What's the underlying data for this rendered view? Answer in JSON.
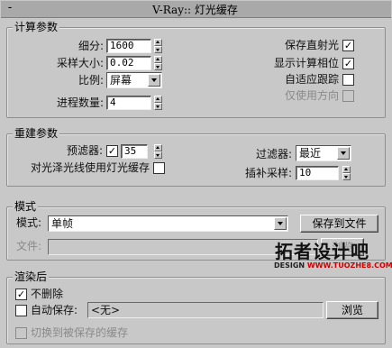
{
  "window": {
    "title": "V-Ray:: 灯光缓存",
    "collapse_glyph": "-"
  },
  "calc": {
    "legend": "计算参数",
    "subdivs_label": "细分:",
    "subdivs_value": "1600",
    "sample_size_label": "采样大小:",
    "sample_size_value": "0.02",
    "scale_label": "比例:",
    "scale_value": "屏幕",
    "passes_label": "进程数量:",
    "passes_value": "4",
    "store_direct_label": "保存直射光",
    "store_direct_checked": true,
    "show_calc_label": "显示计算相位",
    "show_calc_checked": true,
    "adaptive_label": "自适应跟踪",
    "adaptive_checked": false,
    "use_dirs_label": "仅使用方向",
    "use_dirs_checked": false
  },
  "recon": {
    "legend": "重建参数",
    "prefilter_label": "预滤器:",
    "prefilter_checked": true,
    "prefilter_value": "35",
    "glossy_label": "对光泽光线使用灯光缓存",
    "glossy_checked": false,
    "filter_label": "过滤器:",
    "filter_value": "最近",
    "interp_label": "插补采样:",
    "interp_value": "10"
  },
  "mode": {
    "legend": "模式",
    "mode_label": "模式:",
    "mode_value": "单帧",
    "save_button": "保存到文件",
    "file_label": "文件:",
    "file_value": "",
    "browse_button": "浏览"
  },
  "after": {
    "legend": "渲染后",
    "dont_delete_label": "不删除",
    "dont_delete_checked": true,
    "autosave_label": "自动保存:",
    "autosave_checked": false,
    "autosave_value": "<无>",
    "browse_button": "浏览",
    "switch_label": "切换到被保存的缓存",
    "switch_checked": false
  },
  "watermark": {
    "main": "拓者设计吧",
    "sub_prefix": "DESIGN",
    "sub_url": "WWW.TUOZHE8.COM"
  },
  "icons": {
    "check_glyph": "✓"
  }
}
